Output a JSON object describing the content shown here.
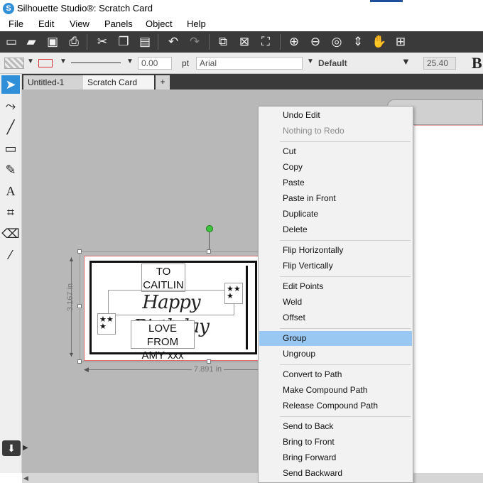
{
  "app": {
    "title": "Silhouette Studio®: Scratch Card",
    "icon": "S",
    "icon_name": "silhouette-logo-icon"
  },
  "menubar": {
    "items": [
      "File",
      "Edit",
      "View",
      "Panels",
      "Object",
      "Help"
    ]
  },
  "toolbar": {
    "buttons": [
      {
        "name": "new-file-icon",
        "glyph": "▭"
      },
      {
        "name": "open-folder-icon",
        "glyph": "▰"
      },
      {
        "name": "save-icon",
        "glyph": "▣"
      },
      {
        "name": "print-icon",
        "glyph": "⎙"
      },
      {
        "name": "cut-icon",
        "glyph": "✂"
      },
      {
        "name": "copy-icon",
        "glyph": "❐"
      },
      {
        "name": "paste-icon",
        "glyph": "▤"
      },
      {
        "name": "undo-icon",
        "glyph": "↶"
      },
      {
        "name": "redo-icon",
        "glyph": "↷"
      },
      {
        "name": "group-icon",
        "glyph": "⧉"
      },
      {
        "name": "ungroup-icon",
        "glyph": "⊠"
      },
      {
        "name": "select-all-icon",
        "glyph": "⛶"
      },
      {
        "name": "zoom-in-icon",
        "glyph": "⊕"
      },
      {
        "name": "zoom-out-icon",
        "glyph": "⊖"
      },
      {
        "name": "zoom-select-icon",
        "glyph": "◎"
      },
      {
        "name": "pan-vertical-icon",
        "glyph": "⇕"
      },
      {
        "name": "hand-pan-icon",
        "glyph": "✋"
      },
      {
        "name": "fit-to-page-icon",
        "glyph": "⊞"
      }
    ]
  },
  "propbar": {
    "stroke_weight": "0.00",
    "stroke_unit": "pt",
    "font_name": "Arial",
    "font_style": "Default",
    "font_size": "25.40",
    "bold_label": "B"
  },
  "tabs": [
    {
      "label": "Untitled-1",
      "active": false
    },
    {
      "label": "Scratch Card",
      "active": true
    }
  ],
  "tab_close": "×",
  "tab_add": "+",
  "tools": [
    {
      "name": "select-tool-icon",
      "glyph": "➤",
      "active": true
    },
    {
      "name": "edit-points-tool-icon",
      "glyph": "⤳"
    },
    {
      "name": "line-tool-icon",
      "glyph": "╱"
    },
    {
      "name": "rectangle-tool-icon",
      "glyph": "▭"
    },
    {
      "name": "pencil-tool-icon",
      "glyph": "✎"
    },
    {
      "name": "text-tool-icon",
      "glyph": "A"
    },
    {
      "name": "knife-tool-icon",
      "glyph": "⌗"
    },
    {
      "name": "eraser-tool-icon",
      "glyph": "⌫"
    },
    {
      "name": "eyedropper-tool-icon",
      "glyph": "⁄"
    }
  ],
  "design": {
    "to_line1": "TO",
    "to_line2": "CAITLIN",
    "script_text": "Happy Birthday",
    "from_line1": "LOVE FROM",
    "from_line2": "AMY xxx",
    "stars": "★ ★\n★",
    "height_label": "3.167 in",
    "width_label": "7.891 in"
  },
  "context_menu": {
    "items": [
      {
        "label": "Undo Edit",
        "state": "normal"
      },
      {
        "label": "Nothing to Redo",
        "state": "disabled"
      },
      {
        "sep": true
      },
      {
        "label": "Cut",
        "state": "normal"
      },
      {
        "label": "Copy",
        "state": "normal"
      },
      {
        "label": "Paste",
        "state": "normal"
      },
      {
        "label": "Paste in Front",
        "state": "normal"
      },
      {
        "label": "Duplicate",
        "state": "normal"
      },
      {
        "label": "Delete",
        "state": "normal"
      },
      {
        "sep": true
      },
      {
        "label": "Flip Horizontally",
        "state": "normal"
      },
      {
        "label": "Flip Vertically",
        "state": "normal"
      },
      {
        "sep": true
      },
      {
        "label": "Edit Points",
        "state": "normal"
      },
      {
        "label": "Weld",
        "state": "normal"
      },
      {
        "label": "Offset",
        "state": "normal"
      },
      {
        "sep": true
      },
      {
        "label": "Group",
        "state": "hover"
      },
      {
        "label": "Ungroup",
        "state": "normal"
      },
      {
        "sep": true
      },
      {
        "label": "Convert to Path",
        "state": "normal"
      },
      {
        "label": "Make Compound Path",
        "state": "normal"
      },
      {
        "label": "Release Compound Path",
        "state": "normal"
      },
      {
        "sep": true
      },
      {
        "label": "Send to Back",
        "state": "normal"
      },
      {
        "label": "Bring to Front",
        "state": "normal"
      },
      {
        "label": "Bring Forward",
        "state": "normal"
      },
      {
        "label": "Send Backward",
        "state": "normal"
      }
    ]
  },
  "colors": {
    "accent_blue": "#2f8fd8",
    "menu_hover": "#99c9f2",
    "toolbar_dark": "#3a3a3a",
    "canvas_gray": "#b8b8b8",
    "cut_line_red": "#e06b6b",
    "rotate_handle_green": "#3ec43e"
  }
}
